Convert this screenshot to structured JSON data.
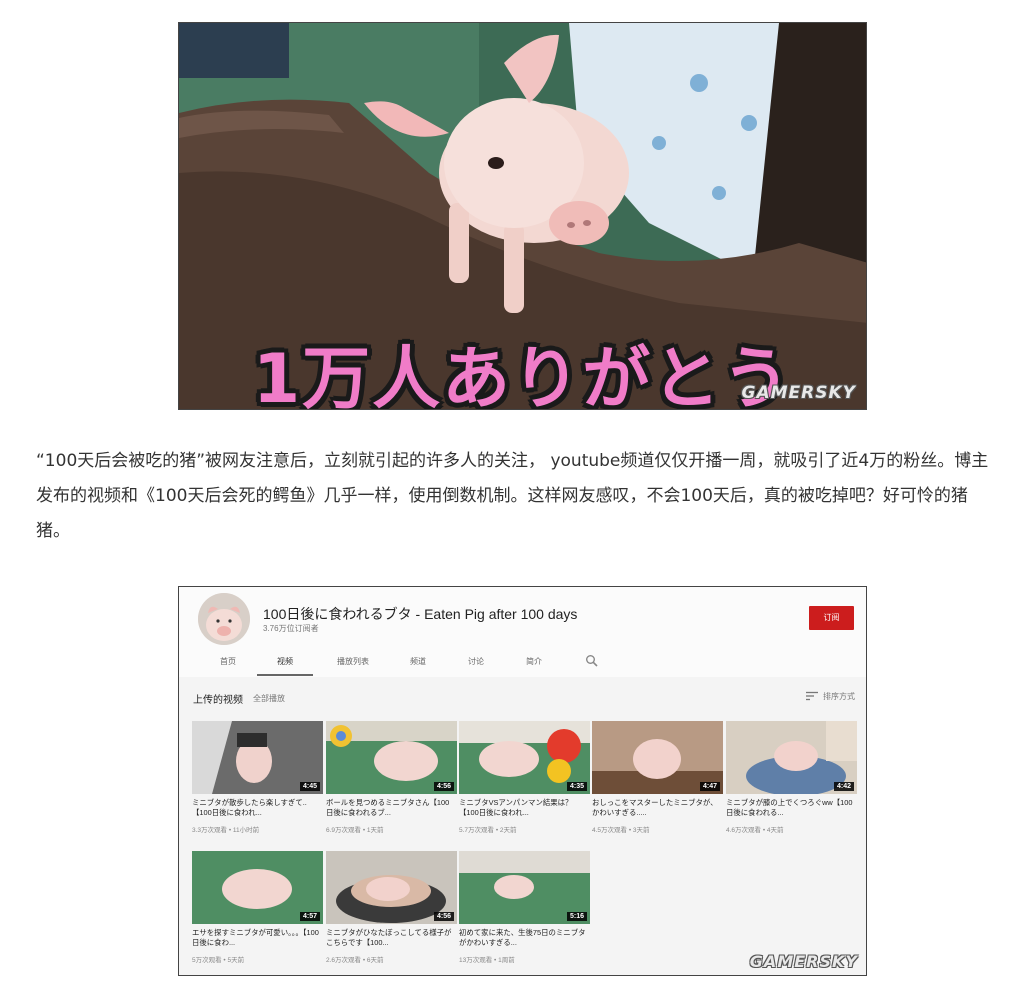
{
  "hero": {
    "caption": "1万人ありがとう",
    "watermark": "GAMERSKY"
  },
  "article": {
    "paragraph": "“100天后会被吃的猪”被网友注意后，立刻就引起的许多人的关注， youtube频道仅仅开播一周，就吸引了近4万的粉丝。博主发布的视频和《100天后会死的鳄鱼》几乎一样，使用倒数机制。这样网友感叹，不会100天后，真的被吃掉吧？好可怜的猪猪。"
  },
  "youtube": {
    "channel_title": "100日後に食われるブタ - Eaten Pig after 100 days",
    "subscribers": "3.76万位订阅者",
    "subscribe_label": "订阅",
    "tabs": [
      "首页",
      "视频",
      "播放列表",
      "频道",
      "讨论",
      "简介"
    ],
    "active_tab": "视频",
    "section_title": "上传的视频",
    "play_all": "全部播放",
    "sort_label": "排序方式",
    "watermark": "GAMERSKY",
    "videos": [
      {
        "title": "ミニブタが散歩したら楽しすぎて..【100日後に食われ...",
        "meta": "3.3万次观看 • 11小时前",
        "duration": "4:45"
      },
      {
        "title": "ボールを見つめるミニブタさん【100日後に食われるブ...",
        "meta": "6.9万次观看 • 1天前",
        "duration": "4:56"
      },
      {
        "title": "ミニブタVSアンパンマン結果は？【100日後に食われ...",
        "meta": "5.7万次观看 • 2天前",
        "duration": "4:35"
      },
      {
        "title": "おしっこをマスターしたミニブタが、かわいすぎる.....",
        "meta": "4.5万次观看 • 3天前",
        "duration": "4:47"
      },
      {
        "title": "ミニブタが膝の上でくつろぐww【100日後に食われる...",
        "meta": "4.6万次观看 • 4天前",
        "duration": "4:42"
      },
      {
        "title": "エサを探すミニブタが可愛い。。。【100日後に食わ...",
        "meta": "5万次观看 • 5天前",
        "duration": "4:57"
      },
      {
        "title": "ミニブタがひなたぼっこしてる様子がこちらです【100...",
        "meta": "2.6万次观看 • 6天前",
        "duration": "4:56"
      },
      {
        "title": "初めて家に来た、生後75日のミニブタがかわいすぎる...",
        "meta": "13万次观看 • 1周前",
        "duration": "5:16"
      }
    ]
  }
}
